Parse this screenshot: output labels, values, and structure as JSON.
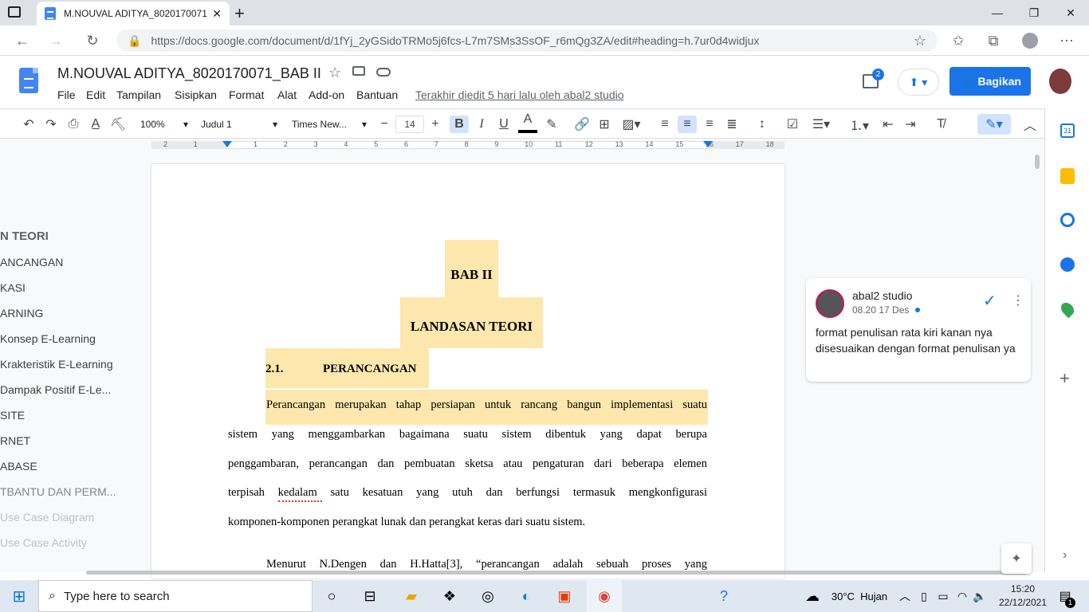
{
  "browser": {
    "tab_title": "M.NOUVAL ADITYA_8020170071_BAB II",
    "url": "https://docs.google.com/document/d/1fYj_2yGSidoTRMo5j6fcs-L7m7SMs3SsOF_r6mQg3ZA/edit#heading=h.7ur0d4widjux"
  },
  "docs": {
    "title": "M.NOUVAL ADITYA_8020170071_BAB II",
    "menus": [
      "File",
      "Edit",
      "Tampilan",
      "Sisipkan",
      "Format",
      "Alat",
      "Add-on",
      "Bantuan"
    ],
    "last_edit": "Terakhir diedit 5 hari lalu oleh abal2 studio",
    "share_label": "Bagikan",
    "comment_badge": "2"
  },
  "toolbar": {
    "zoom": "100%",
    "style": "Judul 1",
    "font": "Times New...",
    "font_size": "14"
  },
  "ruler": {
    "numbers": [
      "2",
      "1",
      "1",
      "2",
      "3",
      "4",
      "5",
      "6",
      "7",
      "8",
      "9",
      "10",
      "11",
      "12",
      "13",
      "14",
      "15",
      "16",
      "17",
      "18"
    ]
  },
  "outline": {
    "items": [
      "N TEORI",
      "ANCANGAN",
      "KASI",
      "ARNING",
      "Konsep E-Learning",
      "Krakteristik E-Learning",
      "Dampak Positif E-Le...",
      "SITE",
      "RNET",
      "ABASE",
      "TBANTU DAN PERM...",
      "Use Case Diagram",
      "Use Case Activity"
    ]
  },
  "document": {
    "heading1": "BAB II",
    "heading2": "LANDASAN TEORI",
    "section_num": "2.1.",
    "section_title": "PERANCANGAN",
    "para1_lines": [
      "Perancangan merupakan tahap persiapan untuk rancang bangun implementasi suatu",
      "sistem yang menggambarkan bagaimana suatu sistem dibentuk yang dapat berupa",
      "penggambaran, perancangan dan pembuatan sketsa atau pengaturan dari beberapa elemen",
      "terpisah kedalam satu kesatuan yang utuh dan berfungsi termasuk mengkonfigurasi",
      "komponen-komponen perangkat lunak dan perangkat keras dari suatu sistem."
    ],
    "para2_line": "Menurut N.Dengen dan H.Hatta[3], “perancangan adalah sebuah proses yang"
  },
  "comment": {
    "author": "abal2 studio",
    "time": "08.20 17 Des",
    "text": "format penulisan rata kiri kanan nya disesuaikan dengan format penulisan ya"
  },
  "taskbar": {
    "search_placeholder": "Type here to search",
    "weather": "30°C  Hujan",
    "time": "15:20",
    "date": "22/12/2021",
    "notif_count": "1"
  }
}
